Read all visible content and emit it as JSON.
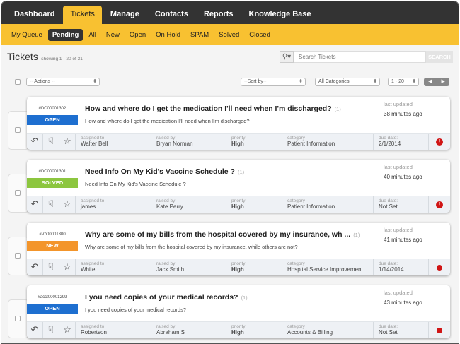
{
  "nav": {
    "tabs": [
      "Dashboard",
      "Tickets",
      "Manage",
      "Contacts",
      "Reports",
      "Knowledge Base"
    ],
    "active": 1
  },
  "subnav": {
    "items": [
      "My Queue",
      "Pending",
      "All",
      "New",
      "Open",
      "On Hold",
      "SPAM",
      "Solved",
      "Closed"
    ],
    "active": 1
  },
  "header": {
    "title": "Tickets",
    "showing": "showing 1 - 20 of 31"
  },
  "search": {
    "placeholder": "Search Tickets",
    "button": "SEARCH",
    "icon": "search-icon"
  },
  "controls": {
    "actions": "-- Actions --",
    "sort": "--Sort by--",
    "category": "All Categories",
    "range": "1 - 20",
    "prev": "◀",
    "next": "▶"
  },
  "labels": {
    "last_updated": "last updated",
    "assigned": "assigned to",
    "raised": "raised by",
    "priority": "priority",
    "category": "category",
    "due": "due date:"
  },
  "status_colors": {
    "OPEN": "#1e6fd0",
    "SOLVED": "#8cc63f",
    "NEW": "#f3952b"
  },
  "tickets": [
    {
      "id": "#DC00001302",
      "status": "OPEN",
      "subject": "How and where do I get the medication I'll need when I'm discharged?",
      "count": "(1)",
      "preview": "How and where do I get the medication I'll need when I'm discharged?",
      "updated": "38 minutes ago",
      "assigned": "Walter Bell",
      "raised": "Bryan Norman",
      "priority": "High",
      "category": "Patient Information",
      "due": "2/1/2014",
      "alert": "!"
    },
    {
      "id": "#DC00001301",
      "status": "SOLVED",
      "subject": "Need Info On My Kid's Vaccine Schedule ?",
      "count": "(1)",
      "preview": "Need Info On My Kid's Vaccine Schedule ?",
      "updated": "40 minutes ago",
      "assigned": "james",
      "raised": "Kate Perry",
      "priority": "High",
      "category": "Patient Information",
      "due": "Not Set",
      "alert": "!"
    },
    {
      "id": "#Vb00001300",
      "status": "NEW",
      "subject": "Why are some of my bills from the hospital covered by my insurance, wh ...",
      "count": "(1)",
      "preview": "Why are some of my bills from the hospital covered by my insurance, while others are not?",
      "updated": "41 minutes ago",
      "assigned": "White",
      "raised": "Jack Smith",
      "priority": "High",
      "category": "Hospital Service Improvement",
      "due": "1/14/2014",
      "alert": ""
    },
    {
      "id": "#acct00001299",
      "status": "OPEN",
      "subject": "I you need copies of your medical records?",
      "count": "(1)",
      "preview": "I you need copies of your medical records?",
      "updated": "43 minutes ago",
      "assigned": "Robertson",
      "raised": "Abraham S",
      "priority": "High",
      "category": "Accounts & Billing",
      "due": "Not Set",
      "alert": ""
    }
  ]
}
